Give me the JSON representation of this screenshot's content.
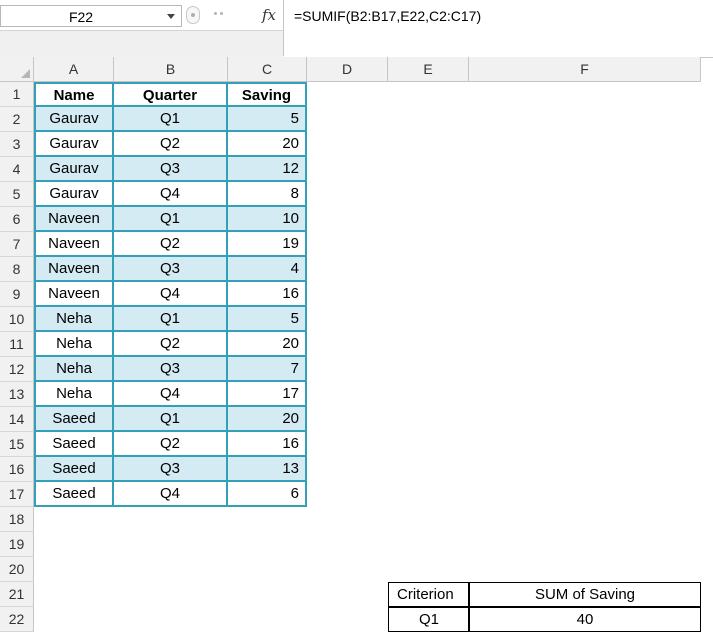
{
  "name_box": {
    "value": "F22"
  },
  "formula_bar": {
    "fx_label": "fx",
    "formula": "=SUMIF(B2:B17,E22,C2:C17)"
  },
  "columns": [
    "A",
    "B",
    "C",
    "D",
    "E",
    "F"
  ],
  "rows": [
    "1",
    "2",
    "3",
    "4",
    "5",
    "6",
    "7",
    "8",
    "9",
    "10",
    "11",
    "12",
    "13",
    "14",
    "15",
    "16",
    "17",
    "18",
    "19",
    "20",
    "21",
    "22"
  ],
  "table": {
    "headers": [
      "Name",
      "Quarter",
      "Saving"
    ],
    "rows": [
      [
        "Gaurav",
        "Q1",
        "5"
      ],
      [
        "Gaurav",
        "Q2",
        "20"
      ],
      [
        "Gaurav",
        "Q3",
        "12"
      ],
      [
        "Gaurav",
        "Q4",
        "8"
      ],
      [
        "Naveen",
        "Q1",
        "10"
      ],
      [
        "Naveen",
        "Q2",
        "19"
      ],
      [
        "Naveen",
        "Q3",
        "4"
      ],
      [
        "Naveen",
        "Q4",
        "16"
      ],
      [
        "Neha",
        "Q1",
        "5"
      ],
      [
        "Neha",
        "Q2",
        "20"
      ],
      [
        "Neha",
        "Q3",
        "7"
      ],
      [
        "Neha",
        "Q4",
        "17"
      ],
      [
        "Saeed",
        "Q1",
        "20"
      ],
      [
        "Saeed",
        "Q2",
        "16"
      ],
      [
        "Saeed",
        "Q3",
        "13"
      ],
      [
        "Saeed",
        "Q4",
        "6"
      ]
    ]
  },
  "criterion_box": {
    "label_criterion": "Criterion",
    "label_sum": "SUM of Saving",
    "criterion_value": "Q1",
    "sum_value": "40"
  },
  "colors": {
    "table_border": "#31a0b8",
    "band_fill": "#d4ebf3",
    "header_fill": "#f1f1f1"
  }
}
